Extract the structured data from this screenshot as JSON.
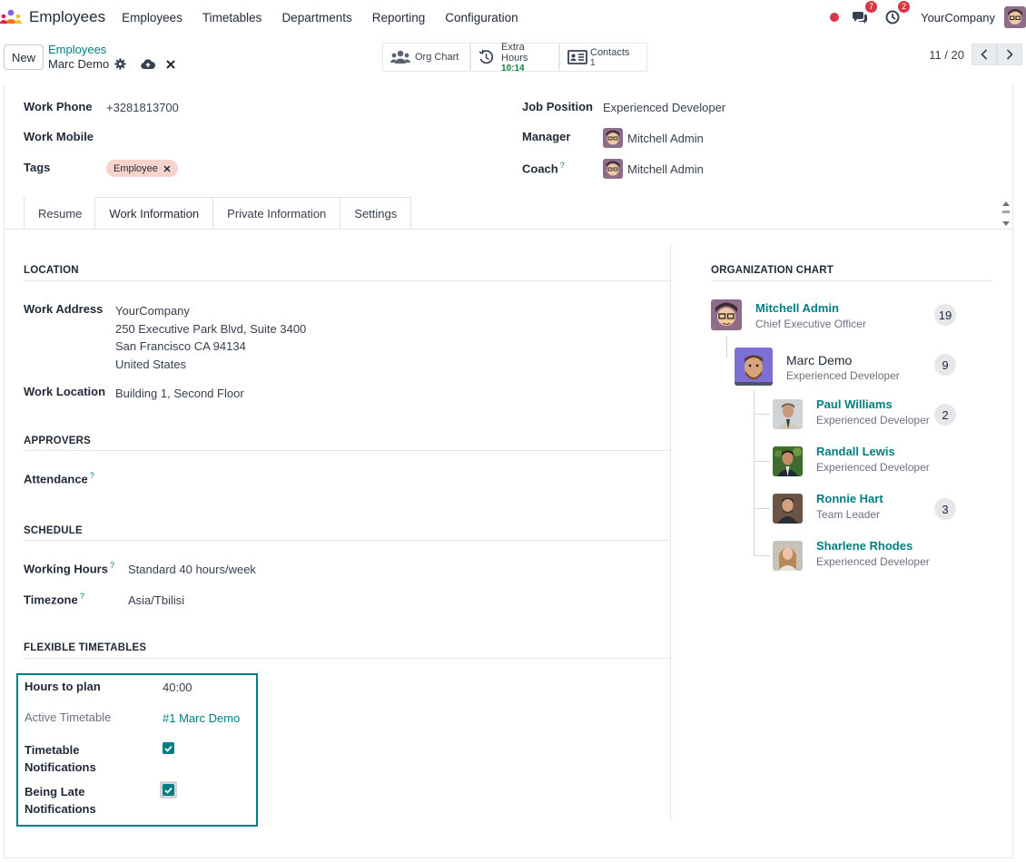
{
  "navbar": {
    "app_title": "Employees",
    "menu": [
      "Employees",
      "Timetables",
      "Departments",
      "Reporting",
      "Configuration"
    ],
    "messages_count": "7",
    "activities_count": "2",
    "company": "YourCompany"
  },
  "control": {
    "new_label": "New",
    "breadcrumb_parent": "Employees",
    "breadcrumb_current": "Marc Demo",
    "smart_buttons": {
      "org_chart": "Org Chart",
      "extra_hours_label": "Extra Hours",
      "extra_hours_value": "10:14",
      "contacts_label": "Contacts",
      "contacts_value": "1"
    },
    "pager": "11 / 20"
  },
  "form": {
    "work_phone_label": "Work Phone",
    "work_phone": "+3281813700",
    "work_mobile_label": "Work Mobile",
    "tags_label": "Tags",
    "tag": "Employee",
    "job_position_label": "Job Position",
    "job_position": "Experienced Developer",
    "manager_label": "Manager",
    "manager": "Mitchell Admin",
    "coach_label": "Coach",
    "coach": "Mitchell Admin"
  },
  "tabs": [
    "Resume",
    "Work Information",
    "Private Information",
    "Settings"
  ],
  "active_tab": "Work Information",
  "location": {
    "title": "LOCATION",
    "work_address_label": "Work Address",
    "address_lines": [
      "YourCompany",
      "250 Executive Park Blvd, Suite 3400",
      "San Francisco CA 94134",
      "United States"
    ],
    "work_location_label": "Work Location",
    "work_location": "Building 1, Second Floor"
  },
  "approvers": {
    "title": "APPROVERS",
    "attendance_label": "Attendance"
  },
  "schedule": {
    "title": "SCHEDULE",
    "working_hours_label": "Working Hours",
    "working_hours": "Standard 40 hours/week",
    "timezone_label": "Timezone",
    "timezone": "Asia/Tbilisi"
  },
  "flexible": {
    "title": "FLEXIBLE TIMETABLES",
    "hours_label": "Hours to plan",
    "hours": "40:00",
    "active_label": "Active Timetable",
    "active": "#1 Marc Demo",
    "notif_label_1": "Timetable",
    "notif_label_2": "Notifications",
    "late_label_1": "Being Late",
    "late_label_2": "Notifications",
    "timetable_notifications": true,
    "being_late_notifications": true
  },
  "org_chart": {
    "title": "ORGANIZATION CHART",
    "manager": {
      "name": "Mitchell Admin",
      "job": "Chief Executive Officer",
      "count": "19"
    },
    "self": {
      "name": "Marc Demo",
      "job": "Experienced Developer",
      "count": "9"
    },
    "subordinates": [
      {
        "name": "Paul Williams",
        "job": "Experienced Developer",
        "count": "2"
      },
      {
        "name": "Randall Lewis",
        "job": "Experienced Developer",
        "count": ""
      },
      {
        "name": "Ronnie Hart",
        "job": "Team Leader",
        "count": "3"
      },
      {
        "name": "Sharlene Rhodes",
        "job": "Experienced Developer",
        "count": ""
      }
    ]
  },
  "colors": {
    "accent": "#017e84",
    "badge": "#dc3545",
    "tag_bg": "#f7d4cb"
  }
}
